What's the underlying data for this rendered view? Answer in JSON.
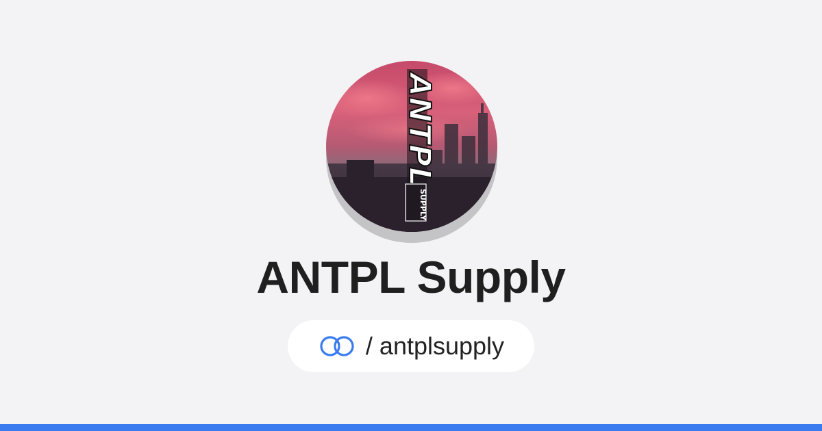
{
  "profile": {
    "name": "ANTPL Supply",
    "handle": "/ antplsupply",
    "avatar_logo_text": "ANTPL",
    "avatar_sub_text": "SUPPLY"
  },
  "icons": {
    "link_icon": "link-rings-icon"
  },
  "colors": {
    "background": "#f3f3f5",
    "accent": "#3a7bf0",
    "title": "#1f1f1f",
    "pill_background": "#ffffff"
  }
}
